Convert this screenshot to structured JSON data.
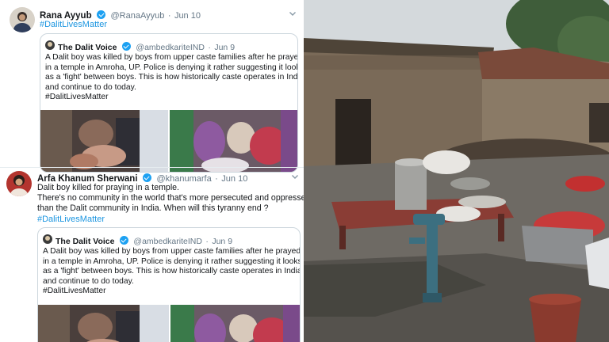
{
  "tweet1": {
    "name": "Rana Ayyub",
    "handle": "@RanaAyyub",
    "separator": "·",
    "date": "Jun 10",
    "hashtag": "#DalitLivesMatter",
    "quote": {
      "name": "The Dalit Voice",
      "handle": "@ambedkariteIND",
      "separator": "·",
      "date": "Jun 9",
      "lines": [
        "A Dalit boy was killed by boys from upper caste families after he prayed",
        "in a temple in Amroha, UP. Police is denying it rather suggesting it looks",
        "as a 'fight' between boys. This is how historically caste operates in India",
        "and continue to do today.",
        "#DalitLivesMatter"
      ]
    }
  },
  "tweet2": {
    "name": "Arfa Khanum Sherwani",
    "handle": "@khanumarfa",
    "separator": "·",
    "date": "Jun 10",
    "lines": [
      "Dalit boy killed for praying in a temple.",
      "There's no community in the world that's more persecuted and oppressed",
      "than the Dalit community in India. When will this tyranny end ?"
    ],
    "hashtag": "#DalitLivesMatter",
    "quote": {
      "name": "The Dalit Voice",
      "handle": "@ambedkariteIND",
      "separator": "·",
      "date": "Jun 9",
      "lines": [
        "A Dalit boy was killed by boys from upper caste families after he prayed",
        "in a temple in Amroha, UP. Police is denying it rather suggesting it looks",
        "as a 'fight' between boys. This is how historically caste operates in India",
        "and continue to do today.",
        "#DalitLivesMatter"
      ]
    }
  },
  "icons": {
    "verified": "verified-badge-icon",
    "chevron": "chevron-down-icon"
  },
  "colors": {
    "link": "#1b95e0",
    "verified": "#1da1f2",
    "secondary_text": "#657786"
  }
}
